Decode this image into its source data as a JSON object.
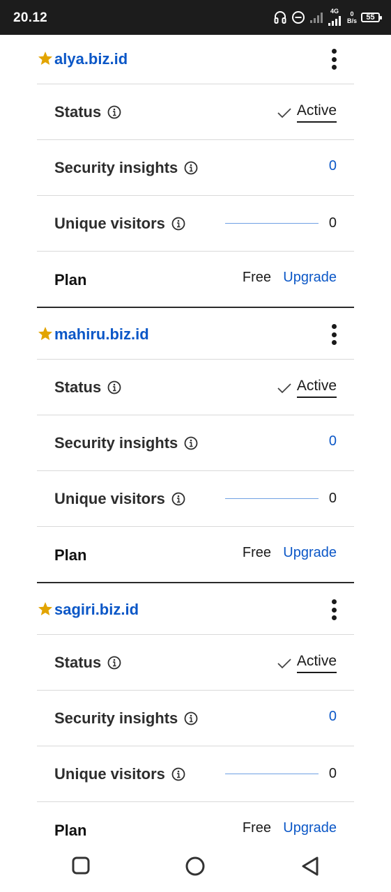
{
  "status_bar": {
    "time": "20.12",
    "network_type": "4G",
    "net_speed_value": "0",
    "net_speed_unit": "B/s",
    "battery": "55",
    "icons": [
      "headphones-icon",
      "do-not-disturb-icon",
      "signal-icon",
      "signal-4g-icon",
      "battery-icon"
    ]
  },
  "sites": [
    {
      "domain": "alya.biz.id",
      "starred": true,
      "status_label": "Status",
      "status_value": "Active",
      "insights_label": "Security insights",
      "insights_value": "0",
      "visitors_label": "Unique visitors",
      "visitors_value": "0",
      "plan_label": "Plan",
      "plan_value": "Free",
      "upgrade_label": "Upgrade"
    },
    {
      "domain": "mahiru.biz.id",
      "starred": true,
      "status_label": "Status",
      "status_value": "Active",
      "insights_label": "Security insights",
      "insights_value": "0",
      "visitors_label": "Unique visitors",
      "visitors_value": "0",
      "plan_label": "Plan",
      "plan_value": "Free",
      "upgrade_label": "Upgrade"
    },
    {
      "domain": "sagiri.biz.id",
      "starred": true,
      "status_label": "Status",
      "status_value": "Active",
      "insights_label": "Security insights",
      "insights_value": "0",
      "visitors_label": "Unique visitors",
      "visitors_value": "0",
      "plan_label": "Plan",
      "plan_value": "Free",
      "upgrade_label": "Upgrade"
    }
  ],
  "colors": {
    "link_blue": "#0b57c7",
    "star_gold": "#e2a400",
    "status_bar_bg": "#1c1c1c"
  },
  "nav_bar": {
    "buttons": [
      "recent-apps-icon",
      "home-icon",
      "back-icon"
    ]
  }
}
